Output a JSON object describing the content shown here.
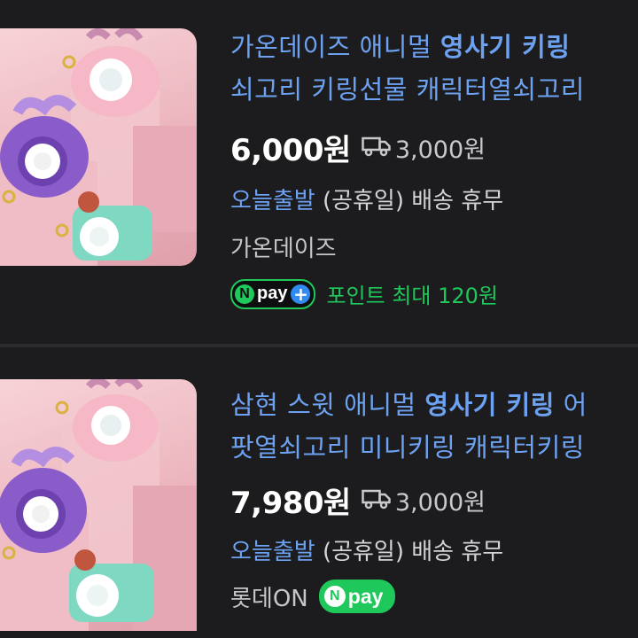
{
  "listings": [
    {
      "title_line1_prefix": "가온데이즈 애니멀 ",
      "title_line1_keyword": "영사기 키링",
      "title_line1_suffix": "",
      "title_line2": "쇠고리 키링선물 캐릭터열쇠고리",
      "price": "6,000원",
      "shipping": "3,000원",
      "delivery_tag": "오늘출발",
      "delivery_rest": " (공휴일) 배송 휴무",
      "seller": "가온데이즈",
      "npay_label": "pay",
      "points": "포인트 최대 120원"
    },
    {
      "title_line1_prefix": "삼현 스윗 애니멀 ",
      "title_line1_keyword": "영사기 키링",
      "title_line1_suffix": " 어",
      "title_line2": "팟열쇠고리 미니키링 캐릭터키링",
      "price": "7,980원",
      "shipping": "3,000원",
      "delivery_tag": "오늘출발",
      "delivery_rest": " (공휴일) 배송 휴무",
      "seller": "롯데ON",
      "npay_label": "pay"
    }
  ],
  "colors": {
    "background": "#1c1c1e",
    "title_blue": "#6da2f2",
    "npay_green": "#1fc85a",
    "npay_plus_blue": "#2f8bf0",
    "thumbnail_pink": "#ecb4bd"
  },
  "icons": {
    "shipping": "delivery-truck-icon",
    "npay": "naver-pay-badge-icon"
  }
}
